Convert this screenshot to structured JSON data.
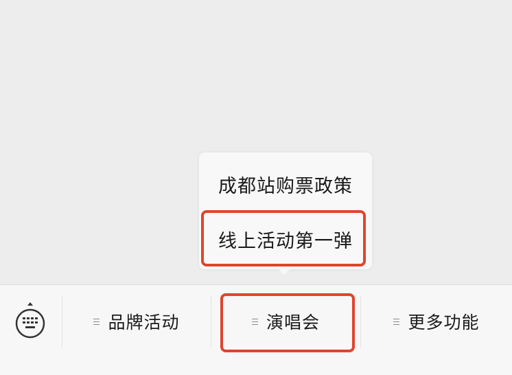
{
  "popup_menu": {
    "items": [
      {
        "label": "成都站购票政策"
      },
      {
        "label": "线上活动第一弹"
      }
    ]
  },
  "bottom_bar": {
    "tabs": [
      {
        "label": "品牌活动"
      },
      {
        "label": "演唱会"
      },
      {
        "label": "更多功能"
      }
    ]
  },
  "colors": {
    "highlight": "#e0442c",
    "background": "#ededed",
    "bar": "#f7f7f7"
  },
  "icons": {
    "keyboard": "keyboard-icon",
    "menu": "menu-lines-icon"
  }
}
